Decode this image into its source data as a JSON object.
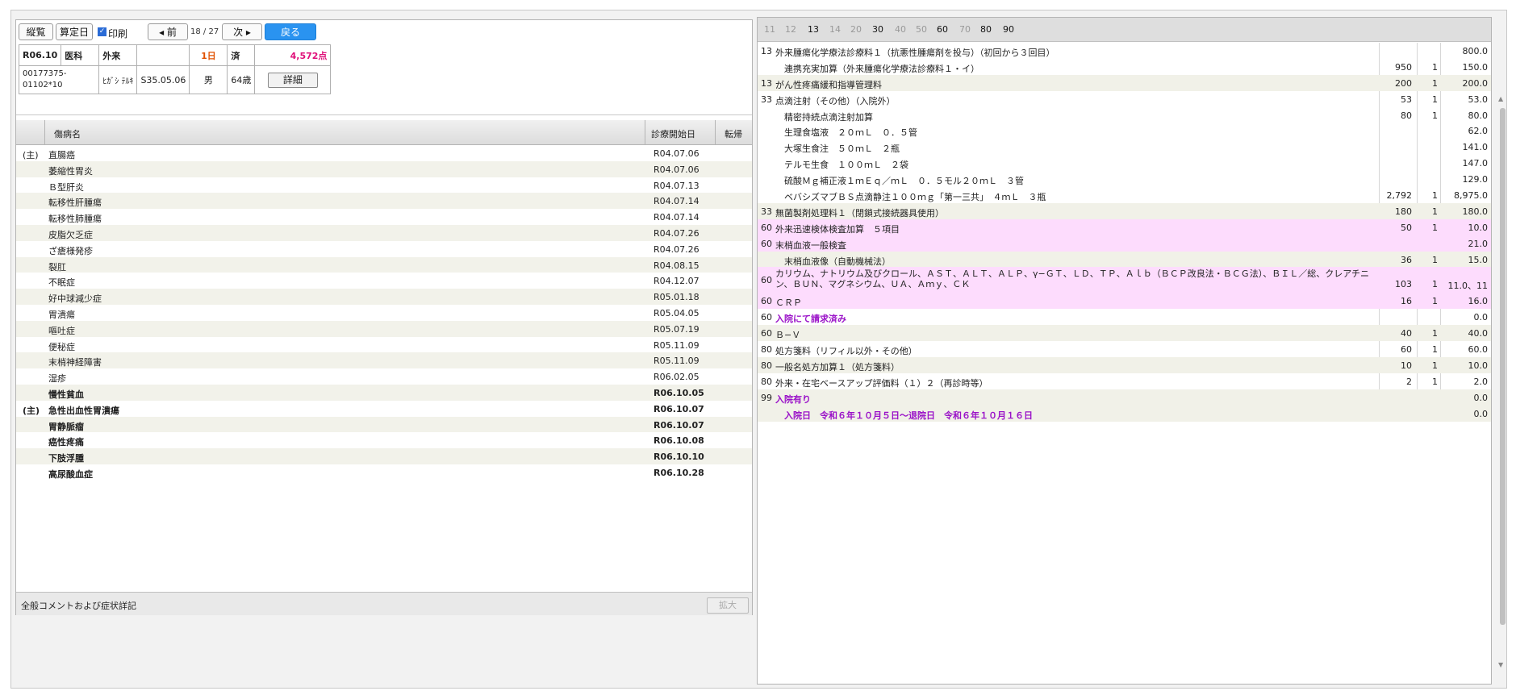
{
  "toolbar": {
    "vertical": "縦覧",
    "calc_date": "算定日",
    "print_label": "印刷",
    "print_checked": "✓",
    "prev": "◂ 前",
    "page": "18 / 27",
    "next": "次 ▸",
    "back": "戻る"
  },
  "patient": {
    "date": "R06.10",
    "dept": "医科",
    "type": "外来",
    "blank": "",
    "days": "1日",
    "done": "済",
    "points": "4,572点",
    "id": "00177375-01102*10",
    "name": "ﾋｶﾞｼ ﾃﾙｷ",
    "birth": "S35.05.06",
    "sex": "男",
    "age": "64歳",
    "detail": "詳細"
  },
  "disease_header": {
    "name": "傷病名",
    "start": "診療開始日",
    "outcome": "転帰"
  },
  "diseases": [
    {
      "pre": "(主)",
      "name": "直腸癌",
      "date": "R04.07.06",
      "bold": false
    },
    {
      "pre": "",
      "name": "萎縮性胃炎",
      "date": "R04.07.06",
      "bold": false
    },
    {
      "pre": "",
      "name": "Ｂ型肝炎",
      "date": "R04.07.13",
      "bold": false
    },
    {
      "pre": "",
      "name": "転移性肝腫瘍",
      "date": "R04.07.14",
      "bold": false
    },
    {
      "pre": "",
      "name": "転移性肺腫瘍",
      "date": "R04.07.14",
      "bold": false
    },
    {
      "pre": "",
      "name": "皮脂欠乏症",
      "date": "R04.07.26",
      "bold": false
    },
    {
      "pre": "",
      "name": "ざ瘡様発疹",
      "date": "R04.07.26",
      "bold": false
    },
    {
      "pre": "",
      "name": "裂肛",
      "date": "R04.08.15",
      "bold": false
    },
    {
      "pre": "",
      "name": "不眠症",
      "date": "R04.12.07",
      "bold": false
    },
    {
      "pre": "",
      "name": "好中球減少症",
      "date": "R05.01.18",
      "bold": false
    },
    {
      "pre": "",
      "name": "胃潰瘍",
      "date": "R05.04.05",
      "bold": false
    },
    {
      "pre": "",
      "name": "嘔吐症",
      "date": "R05.07.19",
      "bold": false
    },
    {
      "pre": "",
      "name": "便秘症",
      "date": "R05.11.09",
      "bold": false
    },
    {
      "pre": "",
      "name": "末梢神経障害",
      "date": "R05.11.09",
      "bold": false
    },
    {
      "pre": "",
      "name": "湿疹",
      "date": "R06.02.05",
      "bold": false
    },
    {
      "pre": "",
      "name": "慢性貧血",
      "date": "R06.10.05",
      "bold": true
    },
    {
      "pre": "(主)",
      "name": "急性出血性胃潰瘍",
      "date": "R06.10.07",
      "bold": true
    },
    {
      "pre": "",
      "name": "胃静脈瘤",
      "date": "R06.10.07",
      "bold": true
    },
    {
      "pre": "",
      "name": "癌性疼痛",
      "date": "R06.10.08",
      "bold": true
    },
    {
      "pre": "",
      "name": "下肢浮腫",
      "date": "R06.10.10",
      "bold": true
    },
    {
      "pre": "",
      "name": "高尿酸血症",
      "date": "R06.10.28",
      "bold": true
    }
  ],
  "comment": {
    "label": "全般コメントおよび症状詳記",
    "expand": "拡大"
  },
  "tabs": [
    {
      "label": "11",
      "active": false
    },
    {
      "label": "12",
      "active": false
    },
    {
      "label": "13",
      "active": true
    },
    {
      "label": "14",
      "active": false
    },
    {
      "label": "20",
      "active": false
    },
    {
      "label": "30",
      "active": true
    },
    {
      "label": "40",
      "active": false
    },
    {
      "label": "50",
      "active": false
    },
    {
      "label": "60",
      "active": true
    },
    {
      "label": "70",
      "active": false
    },
    {
      "label": "80",
      "active": true
    },
    {
      "label": "90",
      "active": true
    }
  ],
  "items": [
    {
      "code": "13",
      "name": "外来腫瘍化学療法診療料１（抗悪性腫瘍剤を投与）（初回から３回目）",
      "unit": "",
      "qty": "",
      "total": "800.0",
      "style": ""
    },
    {
      "code": "",
      "name": "　連携充実加算（外来腫瘍化学療法診療料１・イ）",
      "unit": "950",
      "qty": "1",
      "total": "150.0",
      "style": ""
    },
    {
      "code": "13",
      "name": "がん性疼痛緩和指導管理料",
      "unit": "200",
      "qty": "1",
      "total": "200.0",
      "style": "gray"
    },
    {
      "code": "33",
      "name": "点滴注射（その他）（入院外）",
      "unit": "53",
      "qty": "1",
      "total": "53.0",
      "style": ""
    },
    {
      "code": "",
      "name": "　精密持続点滴注射加算",
      "unit": "80",
      "qty": "1",
      "total": "80.0",
      "style": ""
    },
    {
      "code": "",
      "name": "　生理食塩液　２０ｍＬ　０．５管",
      "unit": "",
      "qty": "",
      "total": "62.0",
      "style": ""
    },
    {
      "code": "",
      "name": "　大塚生食注　５０ｍＬ　２瓶",
      "unit": "",
      "qty": "",
      "total": "141.0",
      "style": ""
    },
    {
      "code": "",
      "name": "　テルモ生食　１００ｍＬ　２袋",
      "unit": "",
      "qty": "",
      "total": "147.0",
      "style": ""
    },
    {
      "code": "",
      "name": "　硫酸Ｍｇ補正液１ｍＥｑ／ｍＬ　０．５モル２０ｍＬ　３管",
      "unit": "",
      "qty": "",
      "total": "129.0",
      "style": ""
    },
    {
      "code": "",
      "name": "　ベバシズマブＢＳ点滴静注１００ｍｇ「第一三共」　４ｍＬ　３瓶",
      "unit": "2,792",
      "qty": "1",
      "total": "8,975.0",
      "style": ""
    },
    {
      "code": "33",
      "name": "無菌製剤処理料１（閉鎖式接続器具使用）",
      "unit": "180",
      "qty": "1",
      "total": "180.0",
      "style": "gray"
    },
    {
      "code": "60",
      "name": "外来迅速検体検査加算　５項目",
      "unit": "50",
      "qty": "1",
      "total": "10.0",
      "style": "pink"
    },
    {
      "code": "60",
      "name": "末梢血液一般検査",
      "unit": "",
      "qty": "",
      "total": "21.0",
      "style": "pink"
    },
    {
      "code": "",
      "name": "　末梢血液像（自動機械法）",
      "unit": "36",
      "qty": "1",
      "total": "15.0",
      "style": "gray"
    },
    {
      "code": "60",
      "name": "カリウム、ナトリウム及びクロール、ＡＳＴ、ＡＬＴ、ＡＬＰ、γ−ＧＴ、ＬＤ、ＴＰ、Ａｌｂ（ＢＣＰ改良法・ＢＣＧ法）、ＢＩＬ／総、クレアチニン、ＢＵＮ、マグネシウム、ＵＡ、Ａｍｙ、ＣＫ",
      "unit": "103",
      "qty": "1",
      "total": "11.0、11",
      "style": "pink tall"
    },
    {
      "code": "60",
      "name": "ＣＲＰ",
      "unit": "16",
      "qty": "1",
      "total": "16.0",
      "style": "pink"
    },
    {
      "code": "60",
      "name": "入院にて請求済み",
      "unit": "",
      "qty": "",
      "total": "0.0",
      "style": "purplerow"
    },
    {
      "code": "60",
      "name": "Ｂ−Ｖ",
      "unit": "40",
      "qty": "1",
      "total": "40.0",
      "style": "gray"
    },
    {
      "code": "80",
      "name": "処方箋料（リフィル以外・その他）",
      "unit": "60",
      "qty": "1",
      "total": "60.0",
      "style": ""
    },
    {
      "code": "80",
      "name": "一般名処方加算１（処方箋料）",
      "unit": "10",
      "qty": "1",
      "total": "10.0",
      "style": "gray"
    },
    {
      "code": "80",
      "name": "外来・在宅ベースアップ評価料（１）２（再診時等）",
      "unit": "2",
      "qty": "1",
      "total": "2.0",
      "style": ""
    },
    {
      "code": "99",
      "name": "入院有り",
      "unit": "",
      "qty": "",
      "total": "0.0",
      "style": "gray purplerow"
    },
    {
      "code": "",
      "name": "　入院日　令和６年１０月５日〜退院日　令和６年１０月１６日",
      "unit": "",
      "qty": "",
      "total": "0.0",
      "style": "gray purplerow"
    }
  ]
}
